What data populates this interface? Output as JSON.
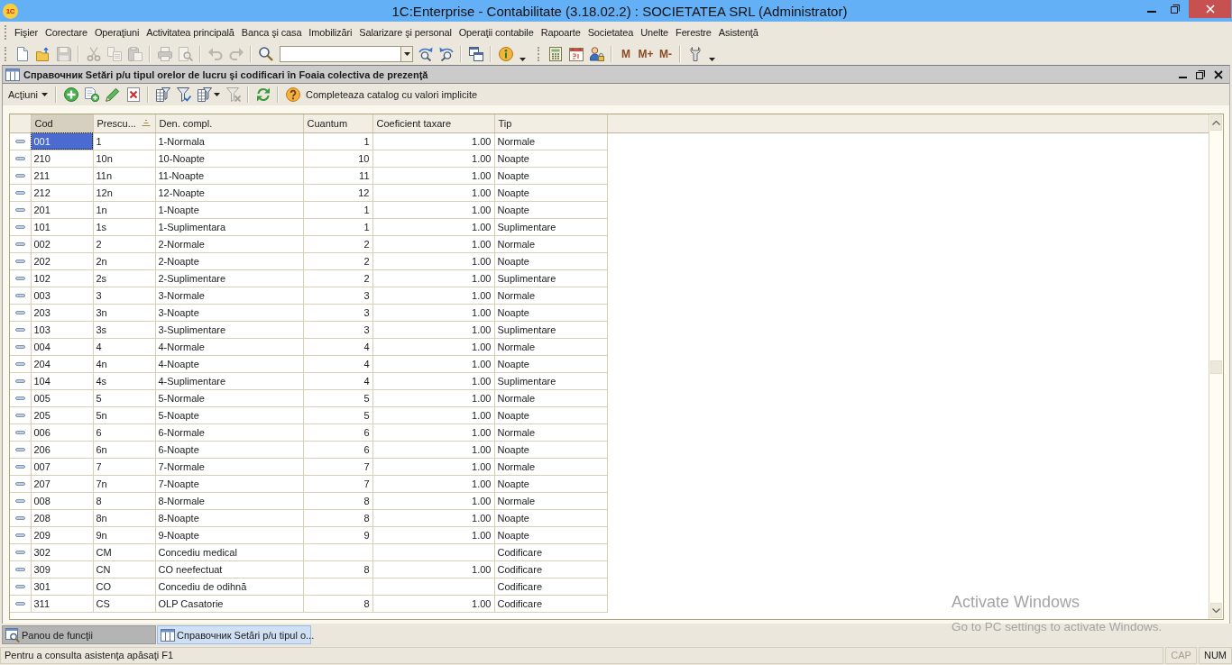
{
  "window": {
    "logo": "1C",
    "title": "1C:Enterprise - Contabilitate (3.18.02.2) : SOCIETATEA SRL (Administrator)"
  },
  "menu": [
    "Fişier",
    "Corectare",
    "Operaţiuni",
    "Activitatea principală",
    "Banca şi casa",
    "Imobilizări",
    "Salarizare şi personal",
    "Operaţii contabile",
    "Rapoarte",
    "Societatea",
    "Unelte",
    "Ferestre",
    "Asistenţă"
  ],
  "toolbars": [
    {
      "groups": [
        [
          {
            "kind": "new",
            "disabled": false
          },
          {
            "kind": "open",
            "disabled": false
          },
          {
            "kind": "save",
            "disabled": true
          }
        ],
        [
          {
            "kind": "cut",
            "disabled": true
          },
          {
            "kind": "copy",
            "disabled": true
          },
          {
            "kind": "paste",
            "disabled": true
          }
        ],
        [
          {
            "kind": "print",
            "disabled": true
          },
          {
            "kind": "preview",
            "disabled": true
          }
        ],
        [
          {
            "kind": "undo",
            "disabled": true
          },
          {
            "kind": "redo",
            "disabled": true
          }
        ],
        [
          {
            "kind": "find",
            "disabled": false
          },
          {
            "kind": "search_field",
            "disabled": false
          },
          {
            "kind": "find_next",
            "disabled": false
          },
          {
            "kind": "find_prev",
            "disabled": false
          }
        ],
        [
          {
            "kind": "windows",
            "disabled": false
          }
        ],
        [
          {
            "kind": "info",
            "disabled": false
          },
          {
            "kind": "more",
            "disabled": false
          }
        ]
      ]
    },
    {
      "groups": [
        [
          {
            "kind": "calculator",
            "disabled": false
          },
          {
            "kind": "calendar",
            "disabled": false
          },
          {
            "kind": "users",
            "disabled": false
          }
        ],
        [
          {
            "kind": "text",
            "label": "M",
            "disabled": false
          },
          {
            "kind": "text",
            "label": "M+",
            "disabled": false
          },
          {
            "kind": "text",
            "label": "M-",
            "disabled": false
          }
        ],
        [
          {
            "kind": "tools",
            "disabled": false
          },
          {
            "kind": "more",
            "disabled": false
          }
        ]
      ]
    }
  ],
  "document": {
    "title": "Справочник Setări p/u tipul orelor de lucru şi codificari în Foaia colectiva de prezenţă",
    "actions": "Acţiuni",
    "toolbar": [
      [
        {
          "kind": "add",
          "disabled": false
        },
        {
          "kind": "add_copy",
          "disabled": false
        },
        {
          "kind": "edit",
          "disabled": false
        },
        {
          "kind": "delete",
          "disabled": false
        }
      ],
      [
        {
          "kind": "filter_list",
          "disabled": false
        },
        {
          "kind": "filter_check",
          "disabled": false
        },
        {
          "kind": "filter_menu",
          "disabled": false
        },
        {
          "kind": "filter_clear",
          "disabled": true
        }
      ],
      [
        {
          "kind": "refresh",
          "disabled": false
        }
      ],
      [
        {
          "kind": "help",
          "label": "Completeaza catalog cu valori implicite",
          "disabled": false
        }
      ]
    ],
    "table": {
      "columns": [
        {
          "label": "Cod",
          "kind": "text",
          "selected": true,
          "sorted": false
        },
        {
          "label": "Prescu...",
          "kind": "text",
          "selected": false,
          "sorted": true
        },
        {
          "label": "Den. compl.",
          "kind": "text",
          "selected": false,
          "sorted": false
        },
        {
          "label": "Cuantum",
          "kind": "number",
          "selected": false,
          "sorted": false
        },
        {
          "label": "Coeficient taxare",
          "kind": "number",
          "selected": false,
          "sorted": false
        },
        {
          "label": "Tip",
          "kind": "text",
          "selected": false,
          "sorted": false
        }
      ],
      "rows": [
        {
          "cod": "001",
          "prescu": "1",
          "den_compl": "1-Normala",
          "cuantum": "1",
          "coeficient_taxare": "1.00",
          "tip": "Normale",
          "selected": true
        },
        {
          "cod": "210",
          "prescu": "10n",
          "den_compl": "10-Noapte",
          "cuantum": "10",
          "coeficient_taxare": "1.00",
          "tip": "Noapte",
          "selected": false
        },
        {
          "cod": "211",
          "prescu": "11n",
          "den_compl": "11-Noapte",
          "cuantum": "11",
          "coeficient_taxare": "1.00",
          "tip": "Noapte",
          "selected": false
        },
        {
          "cod": "212",
          "prescu": "12n",
          "den_compl": "12-Noapte",
          "cuantum": "12",
          "coeficient_taxare": "1.00",
          "tip": "Noapte",
          "selected": false
        },
        {
          "cod": "201",
          "prescu": "1n",
          "den_compl": "1-Noapte",
          "cuantum": "1",
          "coeficient_taxare": "1.00",
          "tip": "Noapte",
          "selected": false
        },
        {
          "cod": "101",
          "prescu": "1s",
          "den_compl": "1-Suplimentara",
          "cuantum": "1",
          "coeficient_taxare": "1.00",
          "tip": "Suplimentare",
          "selected": false
        },
        {
          "cod": "002",
          "prescu": "2",
          "den_compl": "2-Normale",
          "cuantum": "2",
          "coeficient_taxare": "1.00",
          "tip": "Normale",
          "selected": false
        },
        {
          "cod": "202",
          "prescu": "2n",
          "den_compl": "2-Noapte",
          "cuantum": "2",
          "coeficient_taxare": "1.00",
          "tip": "Noapte",
          "selected": false
        },
        {
          "cod": "102",
          "prescu": "2s",
          "den_compl": "2-Suplimentare",
          "cuantum": "2",
          "coeficient_taxare": "1.00",
          "tip": "Suplimentare",
          "selected": false
        },
        {
          "cod": "003",
          "prescu": "3",
          "den_compl": "3-Normale",
          "cuantum": "3",
          "coeficient_taxare": "1.00",
          "tip": "Normale",
          "selected": false
        },
        {
          "cod": "203",
          "prescu": "3n",
          "den_compl": "3-Noapte",
          "cuantum": "3",
          "coeficient_taxare": "1.00",
          "tip": "Noapte",
          "selected": false
        },
        {
          "cod": "103",
          "prescu": "3s",
          "den_compl": "3-Suplimentare",
          "cuantum": "3",
          "coeficient_taxare": "1.00",
          "tip": "Suplimentare",
          "selected": false
        },
        {
          "cod": "004",
          "prescu": "4",
          "den_compl": "4-Normale",
          "cuantum": "4",
          "coeficient_taxare": "1.00",
          "tip": "Normale",
          "selected": false
        },
        {
          "cod": "204",
          "prescu": "4n",
          "den_compl": "4-Noapte",
          "cuantum": "4",
          "coeficient_taxare": "1.00",
          "tip": "Noapte",
          "selected": false
        },
        {
          "cod": "104",
          "prescu": "4s",
          "den_compl": "4-Suplimentare",
          "cuantum": "4",
          "coeficient_taxare": "1.00",
          "tip": "Suplimentare",
          "selected": false
        },
        {
          "cod": "005",
          "prescu": "5",
          "den_compl": "5-Normale",
          "cuantum": "5",
          "coeficient_taxare": "1.00",
          "tip": "Normale",
          "selected": false
        },
        {
          "cod": "205",
          "prescu": "5n",
          "den_compl": "5-Noapte",
          "cuantum": "5",
          "coeficient_taxare": "1.00",
          "tip": "Noapte",
          "selected": false
        },
        {
          "cod": "006",
          "prescu": "6",
          "den_compl": "6-Normale",
          "cuantum": "6",
          "coeficient_taxare": "1.00",
          "tip": "Normale",
          "selected": false
        },
        {
          "cod": "206",
          "prescu": "6n",
          "den_compl": "6-Noapte",
          "cuantum": "6",
          "coeficient_taxare": "1.00",
          "tip": "Noapte",
          "selected": false
        },
        {
          "cod": "007",
          "prescu": "7",
          "den_compl": "7-Normale",
          "cuantum": "7",
          "coeficient_taxare": "1.00",
          "tip": "Normale",
          "selected": false
        },
        {
          "cod": "207",
          "prescu": "7n",
          "den_compl": "7-Noapte",
          "cuantum": "7",
          "coeficient_taxare": "1.00",
          "tip": "Noapte",
          "selected": false
        },
        {
          "cod": "008",
          "prescu": "8",
          "den_compl": "8-Normale",
          "cuantum": "8",
          "coeficient_taxare": "1.00",
          "tip": "Normale",
          "selected": false
        },
        {
          "cod": "208",
          "prescu": "8n",
          "den_compl": "8-Noapte",
          "cuantum": "8",
          "coeficient_taxare": "1.00",
          "tip": "Noapte",
          "selected": false
        },
        {
          "cod": "209",
          "prescu": "9n",
          "den_compl": "9-Noapte",
          "cuantum": "9",
          "coeficient_taxare": "1.00",
          "tip": "Noapte",
          "selected": false
        },
        {
          "cod": "302",
          "prescu": "CM",
          "den_compl": "Concediu medical",
          "tip": "Codificare",
          "selected": false
        },
        {
          "cod": "309",
          "prescu": "CN",
          "den_compl": "CO neefectuat",
          "cuantum": "8",
          "coeficient_taxare": "1.00",
          "tip": "Codificare",
          "selected": false
        },
        {
          "cod": "301",
          "prescu": "CO",
          "den_compl": "Concediu de odihnă",
          "tip": "Codificare",
          "selected": false
        },
        {
          "cod": "311",
          "prescu": "CS",
          "den_compl": "OLP Casatorie",
          "cuantum": "8",
          "coeficient_taxare": "1.00",
          "tip": "Codificare",
          "selected": false
        }
      ]
    }
  },
  "window_tabs": [
    {
      "kind": "panel",
      "label": "Panou de funcţii",
      "selected": false
    },
    {
      "kind": "catalog",
      "label": "Справочник Setări p/u tipul o...",
      "selected": true
    }
  ],
  "status_bar": {
    "hint": "Pentru a consulta asistenţa apăsaţi F1",
    "indicators": [
      {
        "label": "CAP",
        "on": false
      },
      {
        "label": "NUM",
        "on": true
      }
    ]
  },
  "os_notice": {
    "title": "Activate Windows",
    "text": "Go to PC settings to activate Windows."
  }
}
